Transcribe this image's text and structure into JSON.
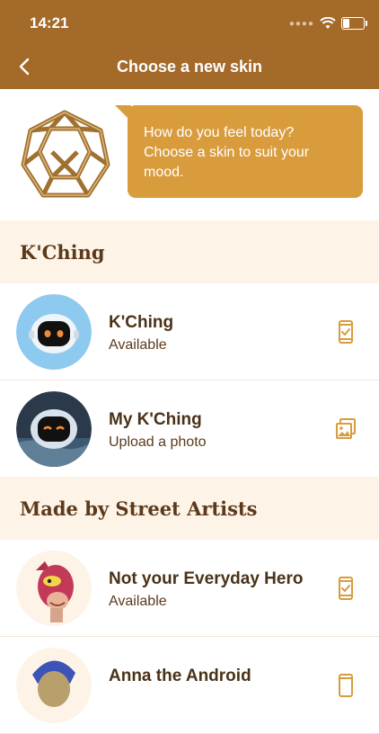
{
  "status": {
    "time": "14:21"
  },
  "header": {
    "title": "Choose a new skin"
  },
  "intro": {
    "message": "How do you feel today? Choose a skin to suit your mood."
  },
  "sections": [
    {
      "title": "K'Ching",
      "items": [
        {
          "title": "K'Ching",
          "subtitle": "Available",
          "action_icon": "phone-check-icon"
        },
        {
          "title": "My K'Ching",
          "subtitle": "Upload a photo",
          "action_icon": "gallery-icon"
        }
      ]
    },
    {
      "title": "Made by Street Artists",
      "items": [
        {
          "title": "Not your Everyday Hero",
          "subtitle": "Available",
          "action_icon": "phone-check-icon"
        },
        {
          "title": "Anna the Android",
          "subtitle": "",
          "action_icon": "phone-check-icon"
        }
      ]
    }
  ],
  "colors": {
    "header": "#a46a2a",
    "accent": "#d99c3d",
    "section_bg": "#fdf3e6",
    "text_dark": "#4a3219"
  }
}
